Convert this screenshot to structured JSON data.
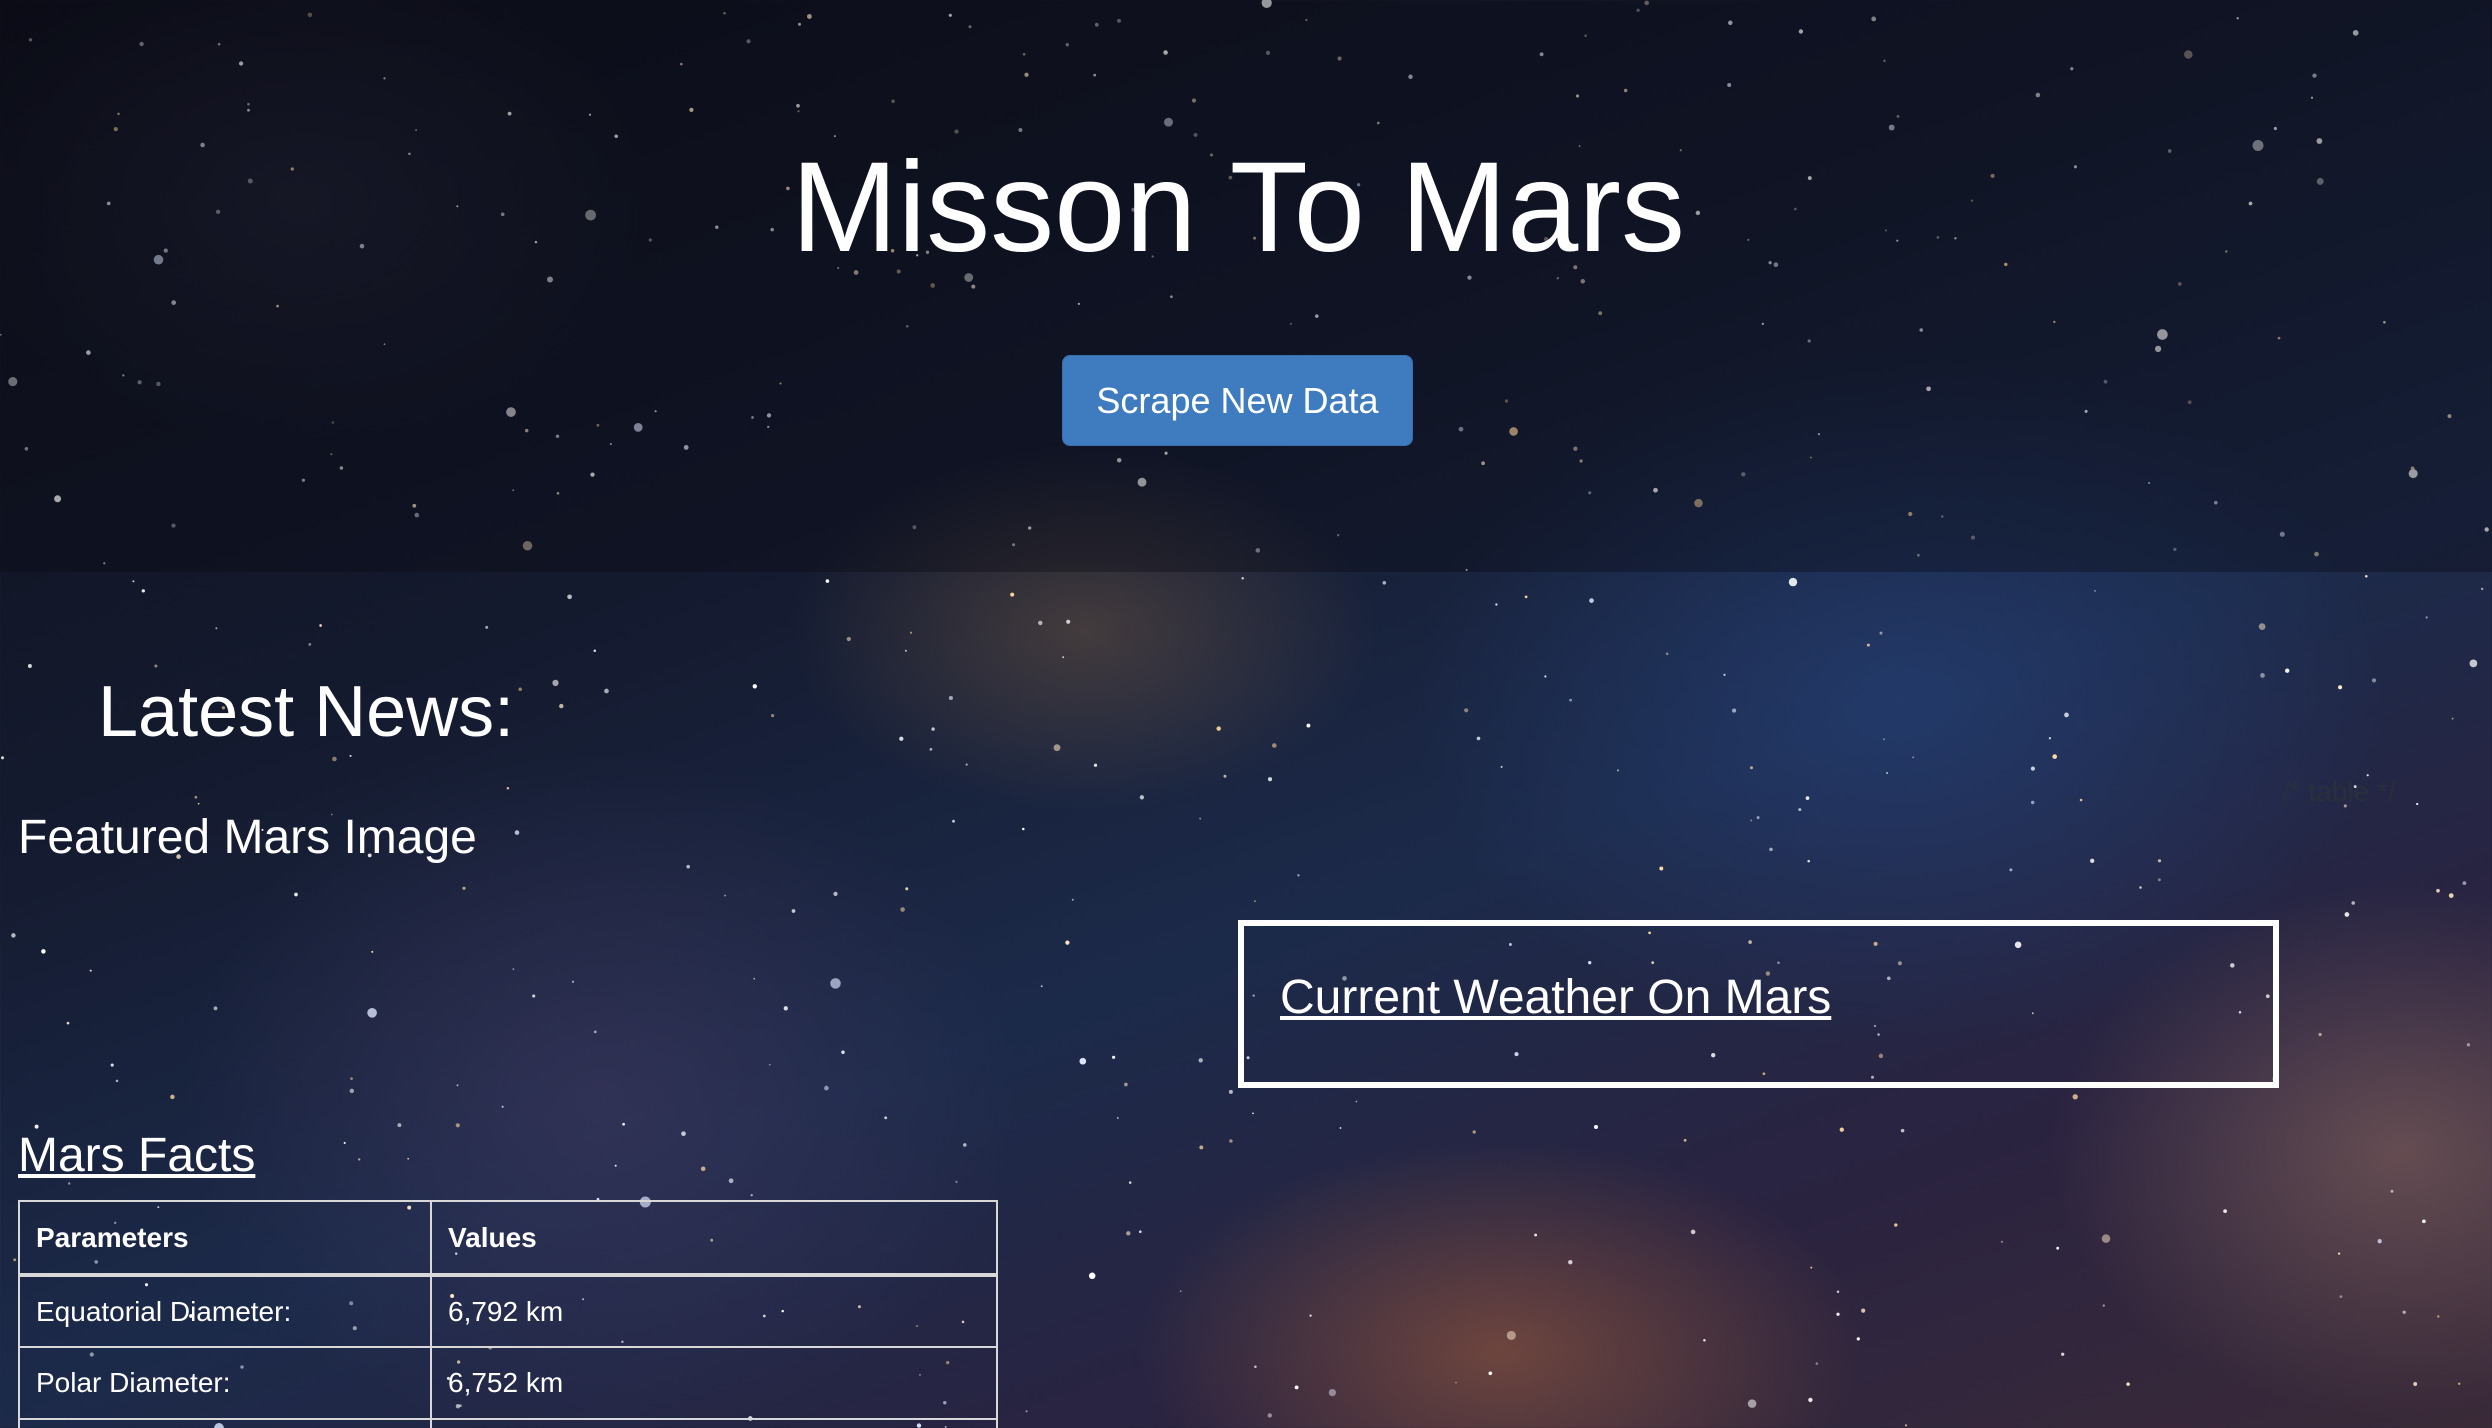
{
  "header": {
    "title": "Misson To Mars",
    "scrape_button_label": "Scrape New Data"
  },
  "news": {
    "heading": "Latest News:"
  },
  "featured_image": {
    "heading": "Featured Mars Image"
  },
  "stray_text": "/* table */",
  "weather": {
    "heading": "Current Weather On Mars"
  },
  "facts": {
    "heading": "Mars Facts",
    "columns": [
      "Parameters",
      "Values"
    ],
    "rows": [
      [
        "Equatorial Diameter:",
        "6,792 km"
      ],
      [
        "Polar Diameter:",
        "6,752 km"
      ],
      [
        "",
        ""
      ]
    ]
  },
  "colors": {
    "button_bg": "#3f7bbf",
    "text": "#ffffff",
    "table_border": "#d8d8d8"
  }
}
